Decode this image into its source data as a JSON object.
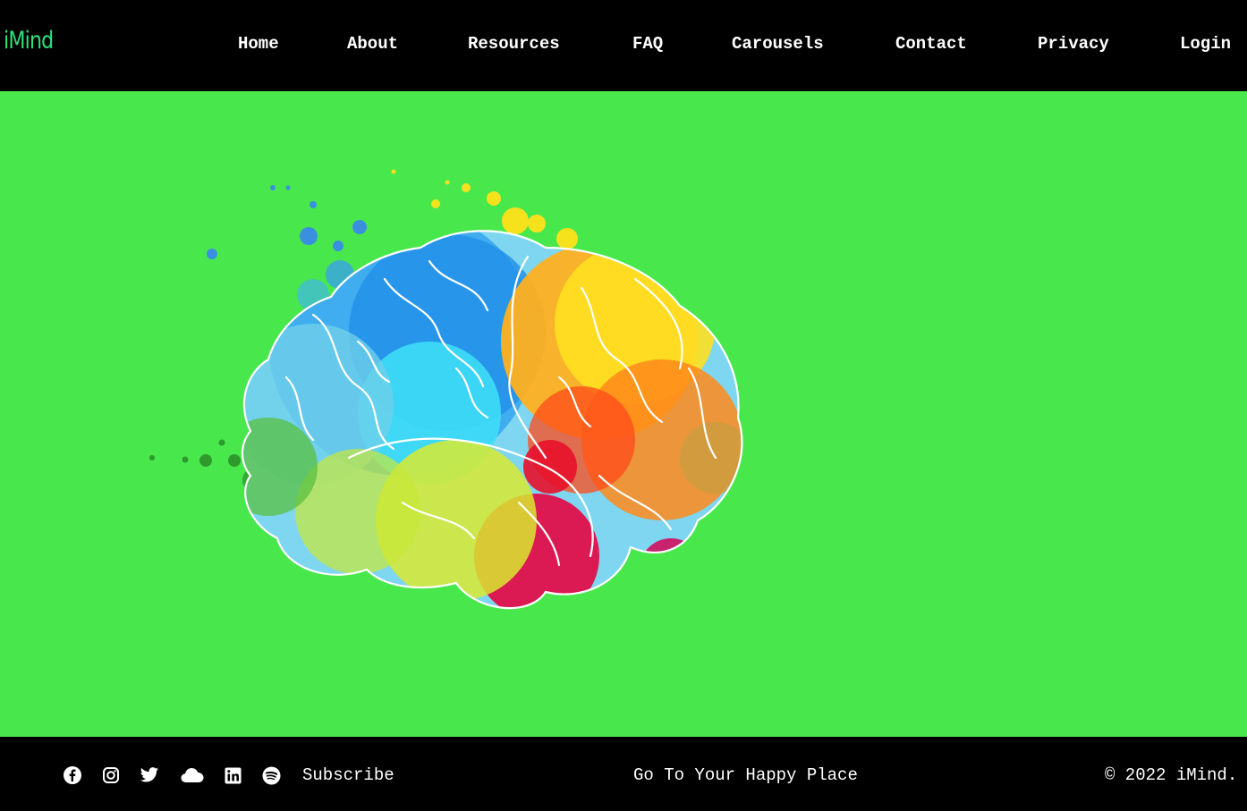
{
  "header": {
    "logo": "iMind",
    "nav": [
      "Home",
      "About",
      "Resources",
      "FAQ",
      "Carousels",
      "Contact",
      "Privacy",
      "Login"
    ]
  },
  "hero": {
    "background_color": "#48e84c",
    "image": "colorful-brain-illustration"
  },
  "footer": {
    "social_icons": [
      "facebook-icon",
      "instagram-icon",
      "twitter-icon",
      "cloud-icon",
      "linkedin-icon",
      "spotify-icon"
    ],
    "subscribe_label": "Subscribe",
    "tagline": "Go To Your Happy Place",
    "copyright": "© 2022 iMind."
  },
  "colors": {
    "accent": "#2fe07a",
    "nav_bg": "#000000",
    "hero_bg": "#48e84c"
  }
}
